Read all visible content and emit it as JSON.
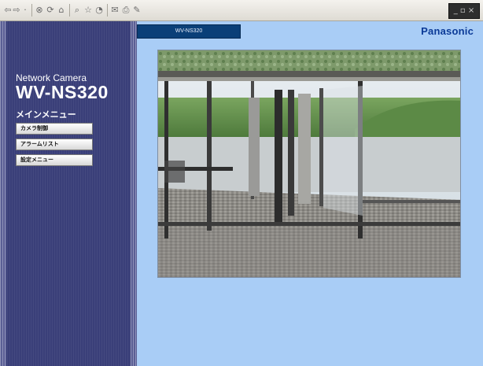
{
  "browser": {
    "toolbar_icons": [
      "back-arrow-icon",
      "forward-arrow-icon",
      "stop-icon",
      "refresh-icon",
      "home-icon",
      "search-icon",
      "favorites-icon",
      "history-icon",
      "mail-icon",
      "print-icon",
      "edit-icon"
    ],
    "window_controls": "_ ▫ ×"
  },
  "sidebar": {
    "product_line": "Network Camera",
    "model": "WV-NS320",
    "menu_title": "メインメニュー",
    "menu_items": [
      {
        "label": "カメラ制御"
      },
      {
        "label": "アラームリスト"
      },
      {
        "label": "設定メニュー"
      }
    ]
  },
  "main": {
    "camera_tab": "WV-NS320",
    "brand_logo": "Panasonic",
    "feed": {
      "icon": "camera-feed-image"
    }
  },
  "colors": {
    "sidebar_bg": "#3a3f79",
    "main_bg": "#a9cdf6",
    "tab_bg": "#0a3f78",
    "logo": "#0b3a97"
  }
}
